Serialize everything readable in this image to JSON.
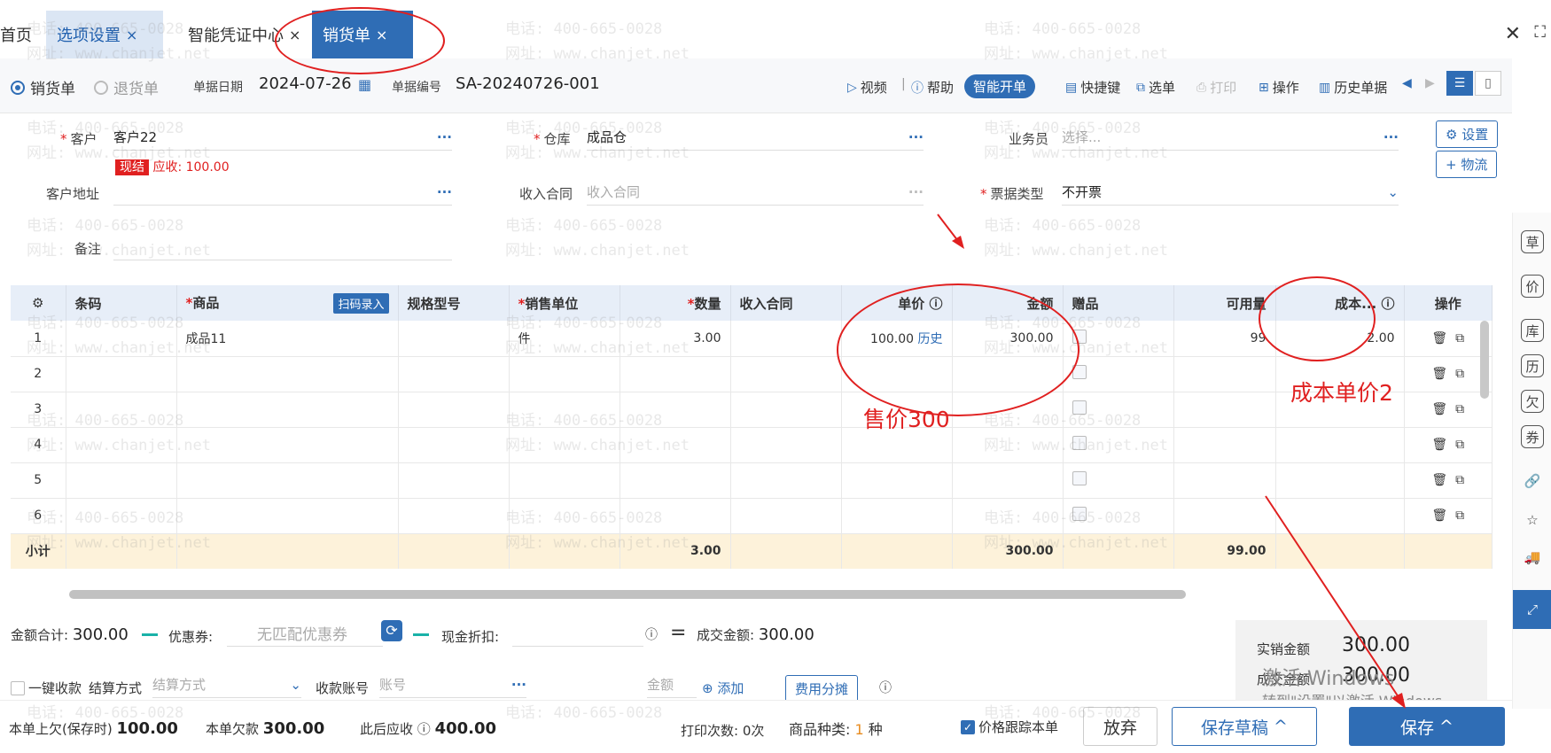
{
  "tabs": {
    "home": "首页",
    "options": "选项设置",
    "voucher": "智能凭证中心",
    "sales": "销货单",
    "close": "×"
  },
  "window": {
    "close": "✕",
    "maximize": "⛶"
  },
  "toolbar": {
    "type_sales": "销货单",
    "type_return": "退货单",
    "date_label": "单据日期",
    "date_value": "2024-07-26",
    "no_label": "单据编号",
    "no_value": "SA-20240726-001",
    "video": "视频",
    "separator": "|",
    "help": "帮助",
    "smart": "智能开单",
    "shortcut": "快捷键",
    "select": "选单",
    "print": "打印",
    "operate": "操作",
    "history": "历史单据"
  },
  "form": {
    "customer_label": "客户",
    "customer_value": "客户22",
    "cash_tag": "现结",
    "receivable": "应收: 100.00",
    "warehouse_label": "仓库",
    "warehouse_value": "成品仓",
    "salesman_label": "业务员",
    "salesman_placeholder": "选择...",
    "address_label": "客户地址",
    "contract_label": "收入合同",
    "contract_placeholder": "收入合同",
    "invoice_label": "票据类型",
    "invoice_value": "不开票",
    "remark_label": "备注",
    "settings_btn": "设置",
    "logistics_btn": "物流",
    "more": "···",
    "required": "*"
  },
  "grid": {
    "headers": [
      "条码",
      "商品",
      "规格型号",
      "销售单位",
      "数量",
      "收入合同",
      "单价",
      "金额",
      "赠品",
      "可用量",
      "成本...",
      "操作"
    ],
    "scan_tag": "扫码录入",
    "history_link": "历史",
    "rows": [
      {
        "no": "1",
        "product": "成品11",
        "unit": "件",
        "qty": "3.00",
        "price": "100.00",
        "amount": "300.00",
        "avail": "99",
        "cost": "2.00"
      },
      {
        "no": "2"
      },
      {
        "no": "3"
      },
      {
        "no": "4"
      },
      {
        "no": "5"
      },
      {
        "no": "6"
      }
    ],
    "subtotal_label": "小计",
    "subtotal_qty": "3.00",
    "subtotal_amount": "300.00",
    "subtotal_avail": "99.00"
  },
  "summary": {
    "total_label": "金额合计:",
    "total_value": "300.00",
    "coupon_label": "优惠券:",
    "coupon_placeholder": "无匹配优惠券",
    "discount_label": "现金折扣:",
    "deal_label": "成交金额:",
    "deal_value": "300.00",
    "onekey": "一键收款",
    "settle_label": "结算方式",
    "settle_placeholder": "结算方式",
    "account_label": "收款账号",
    "account_placeholder": "账号",
    "amount_placeholder": "金额",
    "add": "添加",
    "split": "费用分摊",
    "actual_label": "实销金额",
    "actual_value": "300.00",
    "deal2_label": "成交金额",
    "deal2_value": "300.00"
  },
  "footer": {
    "prev_debt_label": "本单上欠(保存时)",
    "prev_debt": "100.00",
    "this_debt_label": "本单欠款",
    "this_debt": "300.00",
    "after_label": "此后应收",
    "after": "400.00",
    "print_count": "打印次数: 0次",
    "kinds_label": "商品种类:",
    "kinds_value": "1",
    "kinds_unit": "种",
    "track": "价格跟踪本单",
    "discard": "放弃",
    "save_draft": "保存草稿",
    "save": "保存"
  },
  "annotations": {
    "sale_price": "售价300",
    "cost_price": "成本单价2"
  },
  "activation": {
    "line1": "激活 Windows",
    "line2": "转到\"设置\"以激活 Windows。"
  },
  "watermark": {
    "phone": "电话: 400-665-0028",
    "site": "网址: www.chanjet.net"
  },
  "rail": [
    "草",
    "价",
    "库",
    "历",
    "欠",
    "券",
    "🔗",
    "☆",
    "🚚",
    "⤢"
  ],
  "colors": {
    "primary": "#2f6db5",
    "danger": "#e02020",
    "subtotal_bg": "#fdf2da",
    "header_bg": "#e7eef8"
  }
}
